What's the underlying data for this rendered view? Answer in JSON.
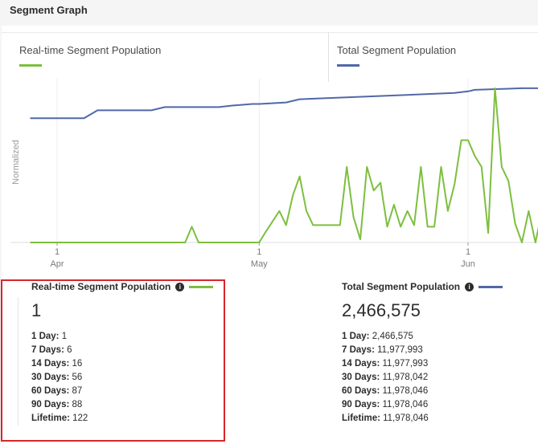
{
  "header": {
    "title": "Segment Graph"
  },
  "legend": {
    "realtime": {
      "label": "Real-time Segment Population",
      "color": "#7dbf3f"
    },
    "total": {
      "label": "Total Segment Population",
      "color": "#5168a8"
    }
  },
  "chart_data": {
    "type": "line",
    "ylabel": "Normalized",
    "x_ticks": [
      {
        "day": "1",
        "month": "Apr"
      },
      {
        "day": "1",
        "month": "May"
      },
      {
        "day": "1",
        "month": "Jun"
      }
    ],
    "ylim": [
      0,
      1
    ],
    "series": [
      {
        "name": "Total Segment Population",
        "color": "#5168a8",
        "x": [
          "Mar 28",
          "Apr 5",
          "Apr 7",
          "Apr 15",
          "Apr 17",
          "Apr 25",
          "Apr 27",
          "Apr 30",
          "May 1",
          "May 5",
          "May 7",
          "May 30",
          "Jun 1",
          "Jun 2",
          "Jun 9",
          "Jun 10",
          "Jun 13"
        ],
        "values": [
          0.79,
          0.79,
          0.84,
          0.84,
          0.86,
          0.86,
          0.87,
          0.88,
          0.88,
          0.89,
          0.91,
          0.95,
          0.96,
          0.97,
          0.98,
          0.98,
          0.98
        ]
      },
      {
        "name": "Real-time Segment Population",
        "color": "#7dbf3f",
        "x": [
          "Mar 28",
          "Apr 20",
          "Apr 21",
          "Apr 22",
          "May 1",
          "May 2",
          "May 4",
          "May 5",
          "May 6",
          "May 7",
          "May 8",
          "May 9",
          "May 10",
          "May 13",
          "May 14",
          "May 15",
          "May 16",
          "May 17",
          "May 18",
          "May 19",
          "May 20",
          "May 21",
          "May 22",
          "May 23",
          "May 24",
          "May 25",
          "May 26",
          "May 27",
          "May 28",
          "May 29",
          "May 30",
          "May 31",
          "Jun 1",
          "Jun 2",
          "Jun 3",
          "Jun 4",
          "Jun 5",
          "Jun 6",
          "Jun 7",
          "Jun 8",
          "Jun 9",
          "Jun 10",
          "Jun 11",
          "Jun 12",
          "Jun 13"
        ],
        "values": [
          0,
          0,
          0.1,
          0,
          0,
          0.07,
          0.2,
          0.11,
          0.3,
          0.42,
          0.2,
          0.11,
          0.11,
          0.11,
          0.48,
          0.16,
          0.02,
          0.48,
          0.33,
          0.38,
          0.1,
          0.24,
          0.1,
          0.2,
          0.11,
          0.48,
          0.1,
          0.1,
          0.48,
          0.2,
          0.37,
          0.65,
          0.65,
          0.55,
          0.48,
          0.06,
          0.98,
          0.48,
          0.39,
          0.12,
          0,
          0.2,
          0,
          0.2,
          0.1
        ]
      }
    ]
  },
  "realtime_panel": {
    "title": "Real-time Segment Population",
    "value": "1",
    "stats": [
      {
        "key": "1 Day:",
        "value": "1"
      },
      {
        "key": "7 Days:",
        "value": "6"
      },
      {
        "key": "14 Days:",
        "value": "16"
      },
      {
        "key": "30 Days:",
        "value": "56"
      },
      {
        "key": "60 Days:",
        "value": "87"
      },
      {
        "key": "90 Days:",
        "value": "88"
      },
      {
        "key": "Lifetime:",
        "value": "122"
      }
    ]
  },
  "total_panel": {
    "title": "Total Segment Population",
    "value": "2,466,575",
    "stats": [
      {
        "key": "1 Day:",
        "value": "2,466,575"
      },
      {
        "key": "7 Days:",
        "value": "11,977,993"
      },
      {
        "key": "14 Days:",
        "value": "11,977,993"
      },
      {
        "key": "30 Days:",
        "value": "11,978,042"
      },
      {
        "key": "60 Days:",
        "value": "11,978,046"
      },
      {
        "key": "90 Days:",
        "value": "11,978,046"
      },
      {
        "key": "Lifetime:",
        "value": "11,978,046"
      }
    ]
  },
  "icons": {
    "info": "info-icon"
  }
}
